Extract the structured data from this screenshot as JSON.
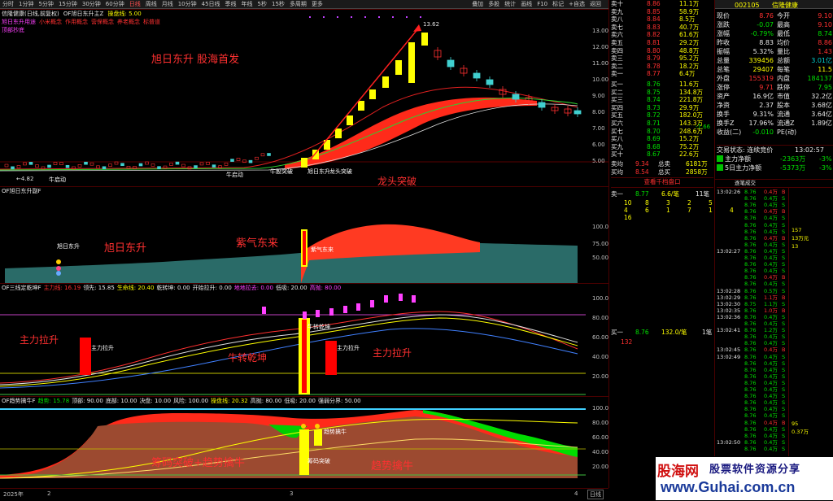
{
  "toolbar": {
    "tabs": [
      "分时",
      "1分钟",
      "5分钟",
      "15分钟",
      "30分钟",
      "60分钟",
      "日线",
      "周线",
      "月线",
      "10分钟",
      "45日线",
      "季线",
      "年线",
      "5秒",
      "15秒",
      "多周期",
      "更多"
    ],
    "active_tab": "日线",
    "right_tabs": [
      "叠加",
      "多股",
      "统计",
      "画线",
      "F10",
      "标记",
      "+自选",
      "返回"
    ]
  },
  "main_pane": {
    "title": "信隆健康(日线,前复权)",
    "indicator": "OF旭日东升主Z",
    "op_line": "操盘线: 5.00",
    "legend": [
      "旭日东升用途",
      "小米概念",
      "作用概念",
      "营保概念",
      "养老概念",
      "标普道"
    ],
    "sub_legend": "顶部抄底",
    "annotation_title": "旭日东升  股海首发",
    "high_label": "13.62",
    "low_label": "4.82",
    "tags": [
      "牛启动",
      "牛启动",
      "牛股突破",
      "旭日东升",
      "龙头突破"
    ],
    "annotations": [
      "牛启动",
      "牛股突破",
      "旭日东升",
      "龙头突破"
    ],
    "axis": [
      "13.00",
      "12.00",
      "11.00",
      "10.00",
      "9.00",
      "8.00",
      "7.00",
      "6.00",
      "5.00"
    ]
  },
  "pane2": {
    "title": "OF旭日东升副F",
    "tags": [
      "旭日东升",
      "紫气东来"
    ],
    "annotations": [
      "旭日东升",
      "紫气东来"
    ],
    "axis": [
      "100.0",
      "75.00",
      "50.00"
    ]
  },
  "pane3": {
    "title": "OF三线定乾坤F",
    "items": [
      {
        "label": "主力线: 16.19",
        "color": "#ff3030"
      },
      {
        "label": "领先: 15.85",
        "color": "#e8e8e8"
      },
      {
        "label": "生命线: 20.40",
        "color": "#ffff00"
      },
      {
        "label": "乾转坤: 0.00",
        "color": "#e8e8e8"
      },
      {
        "label": "开始拉升: 0.00",
        "color": "#e8e8e8"
      },
      {
        "label": "地地拉去: 0.00",
        "color": "#ff40ff"
      },
      {
        "label": "低吸: 20.00",
        "color": "#e8e8e8"
      },
      {
        "label": "高抛: 80.00",
        "color": "#ff40ff"
      }
    ],
    "tags": [
      "主力拉升",
      "牛转乾坤",
      "主力拉升"
    ],
    "annotations": [
      "主力拉升",
      "牛转乾坤",
      "主力拉升"
    ],
    "axis": [
      "100.0",
      "80.00",
      "60.00",
      "40.00",
      "20.00"
    ]
  },
  "pane4": {
    "title": "OF趋势擒牛F",
    "items": [
      {
        "label": "趋势: 15.78",
        "color": "#00e000"
      },
      {
        "label": "顶部: 90.00",
        "color": "#e8e8e8"
      },
      {
        "label": "底部: 10.00",
        "color": "#e8e8e8"
      },
      {
        "label": "决盘: 10.00",
        "color": "#e8e8e8"
      },
      {
        "label": "风险: 100.00",
        "color": "#e8e8e8"
      },
      {
        "label": "操盘线: 20.32",
        "color": "#ffff00"
      },
      {
        "label": "高抛: 80.00",
        "color": "#e8e8e8"
      },
      {
        "label": "低吸: 20.00",
        "color": "#e8e8e8"
      },
      {
        "label": "强弱分界: 50.00",
        "color": "#e8e8e8"
      }
    ],
    "tags": [
      "筹码突破",
      "趋势擒牛"
    ],
    "annotations": [
      "筹码突破+趋势擒牛",
      "趋势擒牛"
    ],
    "axis": [
      "100.0",
      "80.00",
      "60.00",
      "40.00",
      "20.00"
    ]
  },
  "bottom_bar": {
    "year": "2025年",
    "marks": [
      "2",
      "3",
      "4"
    ],
    "period": "日线"
  },
  "order_book": {
    "asks": [
      {
        "label": "卖十",
        "price": "8.86",
        "vol": "11.1万"
      },
      {
        "label": "卖九",
        "price": "8.85",
        "vol": "58.9万"
      },
      {
        "label": "卖八",
        "price": "8.84",
        "vol": "8.5万"
      },
      {
        "label": "卖七",
        "price": "8.83",
        "vol": "40.7万"
      },
      {
        "label": "卖六",
        "price": "8.82",
        "vol": "61.6万"
      },
      {
        "label": "卖五",
        "price": "8.81",
        "vol": "29.2万"
      },
      {
        "label": "卖四",
        "price": "8.80",
        "vol": "48.8万"
      },
      {
        "label": "卖三",
        "price": "8.79",
        "vol": "95.2万"
      },
      {
        "label": "卖二",
        "price": "8.78",
        "vol": "18.2万"
      },
      {
        "label": "卖一",
        "price": "8.77",
        "vol": "6.4万"
      }
    ],
    "bids": [
      {
        "label": "买一",
        "price": "8.76",
        "vol": "11.6万"
      },
      {
        "label": "买二",
        "price": "8.75",
        "vol": "134.8万"
      },
      {
        "label": "买三",
        "price": "8.74",
        "vol": "221.8万"
      },
      {
        "label": "买四",
        "price": "8.73",
        "vol": "29.9万"
      },
      {
        "label": "买五",
        "price": "8.72",
        "vol": "182.0万"
      },
      {
        "label": "买六",
        "price": "8.71",
        "vol": "143.3万"
      },
      {
        "label": "买七",
        "price": "8.70",
        "vol": "248.6万"
      },
      {
        "label": "买八",
        "price": "8.69",
        "vol": "15.2万"
      },
      {
        "label": "买九",
        "price": "8.68",
        "vol": "75.2万"
      },
      {
        "label": "买十",
        "price": "8.67",
        "vol": "22.6万"
      }
    ],
    "side_mark": "-7.66",
    "totals": [
      {
        "label": "卖均",
        "price": "9.34",
        "tag": "总卖",
        "vol": "6181万"
      },
      {
        "label": "买均",
        "price": "8.54",
        "tag": "总买",
        "vol": "2858万"
      }
    ],
    "detail_btn": "查看千档盘口",
    "ask1_row": {
      "label": "卖一",
      "price": "8.77",
      "vol": "6.6/笔",
      "count": "11笔"
    },
    "ask1_grid": [
      [
        "10",
        "8",
        "3",
        "2",
        "5"
      ],
      [
        "4",
        "6",
        "1",
        "7",
        "1",
        "4"
      ],
      [
        "16"
      ]
    ],
    "bid1_row": {
      "label": "买一",
      "price": "8.76",
      "vol": "132.0/笔",
      "count": "1笔"
    },
    "bid1_qty": "132"
  },
  "stats": {
    "code": "002105",
    "name": "信隆健康",
    "rows": [
      {
        "l1": "现价",
        "v1": "8.76",
        "l2": "今开",
        "v2": "9.10",
        "c1": "#ff3030",
        "c2": "#ff3030"
      },
      {
        "l1": "涨跌",
        "v1": "-0.07",
        "l2": "最高",
        "v2": "9.10",
        "c1": "#00e000",
        "c2": "#ff3030"
      },
      {
        "l1": "涨幅",
        "v1": "-0.79%",
        "l2": "最低",
        "v2": "8.74",
        "c1": "#00e000",
        "c2": "#00e000"
      },
      {
        "l1": "昨收",
        "v1": "8.83",
        "l2": "均价",
        "v2": "8.86",
        "c1": "#e8e8e8",
        "c2": "#ff3030"
      },
      {
        "l1": "振幅",
        "v1": "5.32%",
        "l2": "量比",
        "v2": "1.43",
        "c1": "#e8e8e8",
        "c2": "#ff3030"
      },
      {
        "l1": "总量",
        "v1": "339456",
        "l2": "总额",
        "v2": "3.01亿",
        "c1": "#ffff00",
        "c2": "#00d0d0"
      },
      {
        "l1": "总笔",
        "v1": "29407",
        "l2": "每笔",
        "v2": "11.5",
        "c1": "#ffff00",
        "c2": "#ffff00"
      },
      {
        "l1": "外盘",
        "v1": "155319",
        "l2": "内盘",
        "v2": "184137",
        "c1": "#ff3030",
        "c2": "#00e000"
      },
      {
        "l1": "涨停",
        "v1": "9.71",
        "l2": "跌停",
        "v2": "7.95",
        "c1": "#ff3030",
        "c2": "#00e000"
      },
      {
        "l1": "资产",
        "v1": "16.9亿",
        "l2": "市值",
        "v2": "32.2亿",
        "c1": "#e8e8e8",
        "c2": "#e8e8e8"
      },
      {
        "l1": "净资",
        "v1": "2.37",
        "l2": "股本",
        "v2": "3.68亿",
        "c1": "#e8e8e8",
        "c2": "#e8e8e8"
      },
      {
        "l1": "换手",
        "v1": "9.31%",
        "l2": "流通",
        "v2": "3.64亿",
        "c1": "#e8e8e8",
        "c2": "#e8e8e8"
      },
      {
        "l1": "换手Z",
        "v1": "17.96%",
        "l2": "流通Z",
        "v2": "1.89亿",
        "c1": "#e8e8e8",
        "c2": "#e8e8e8"
      },
      {
        "l1": "收益(二)",
        "v1": "-0.010",
        "l2": "PE(动)",
        "v2": "",
        "c1": "#00e000",
        "c2": "#e8e8e8"
      }
    ],
    "trade_status": "交易状态: 连续竞价",
    "trade_time": "13:02:57",
    "flows": [
      {
        "label": "主力净额",
        "value": "-2363万",
        "pct": "-3%"
      },
      {
        "label": "5日主力净额",
        "value": "-5373万",
        "pct": "-3%"
      }
    ]
  },
  "ticks": {
    "header": "逐笔成交",
    "rows": [
      [
        "13:02:26",
        "8.76",
        "0.4万",
        "B"
      ],
      [
        "",
        "8.76",
        "0.4万",
        "S"
      ],
      [
        "",
        "8.76",
        "0.4万",
        "S"
      ],
      [
        "",
        "8.76",
        "0.4万",
        "B"
      ],
      [
        "",
        "8.76",
        "0.4万",
        "S"
      ],
      [
        "",
        "8.76",
        "0.4万",
        "S"
      ],
      [
        "",
        "8.76",
        "0.4万",
        "S"
      ],
      [
        "",
        "8.76",
        "0.4万",
        "B"
      ],
      [
        "",
        "8.76",
        "0.4万",
        "S"
      ],
      [
        "13:02:27",
        "8.76",
        "0.4万",
        "S"
      ],
      [
        "",
        "8.76",
        "0.4万",
        "S"
      ],
      [
        "",
        "8.76",
        "0.4万",
        "S"
      ],
      [
        "",
        "8.76",
        "0.4万",
        "S"
      ],
      [
        "",
        "8.76",
        "0.4万",
        "B"
      ],
      [
        "",
        "8.76",
        "0.4万",
        "S"
      ],
      [
        "13:02:28",
        "8.76",
        "0.5万",
        "S"
      ],
      [
        "13:02:29",
        "8.76",
        "1.1万",
        "B"
      ],
      [
        "13:02:30",
        "8.75",
        "1.1万",
        "S"
      ],
      [
        "13:02:35",
        "8.76",
        "1.0万",
        "B"
      ],
      [
        "13:02:36",
        "8.76",
        "0.4万",
        "S"
      ],
      [
        "",
        "8.76",
        "0.4万",
        "S"
      ],
      [
        "13:02:41",
        "8.76",
        "1.2万",
        "S"
      ],
      [
        "",
        "8.76",
        "0.4万",
        "S"
      ],
      [
        "",
        "8.76",
        "0.4万",
        "S"
      ],
      [
        "13:02:45",
        "8.76",
        "0.4万",
        "B"
      ],
      [
        "13:02:49",
        "8.76",
        "0.4万",
        "S"
      ],
      [
        "",
        "8.76",
        "0.4万",
        "S"
      ],
      [
        "",
        "8.76",
        "0.4万",
        "S"
      ],
      [
        "",
        "8.76",
        "0.4万",
        "S"
      ],
      [
        "",
        "8.76",
        "0.4万",
        "S"
      ],
      [
        "",
        "8.76",
        "0.4万",
        "S"
      ],
      [
        "",
        "8.76",
        "0.4万",
        "S"
      ],
      [
        "",
        "8.76",
        "0.4万",
        "S"
      ],
      [
        "",
        "8.76",
        "0.4万",
        "S"
      ],
      [
        "",
        "8.76",
        "0.4万",
        "S"
      ],
      [
        "",
        "8.76",
        "0.4万",
        "B"
      ],
      [
        "",
        "8.76",
        "0.4万",
        "S"
      ],
      [
        "",
        "8.76",
        "0.4万",
        "S"
      ],
      [
        "13:02:50",
        "8.76",
        "0.4万",
        "S"
      ],
      [
        "",
        "8.76",
        "0.4万",
        "S"
      ]
    ],
    "extras": [
      "157",
      "13万元",
      "13",
      "95",
      "0.37万"
    ]
  },
  "logo": {
    "name": "股海网",
    "slogan": "股票软件资源分享",
    "url": "www.Guhai.com.cn"
  }
}
